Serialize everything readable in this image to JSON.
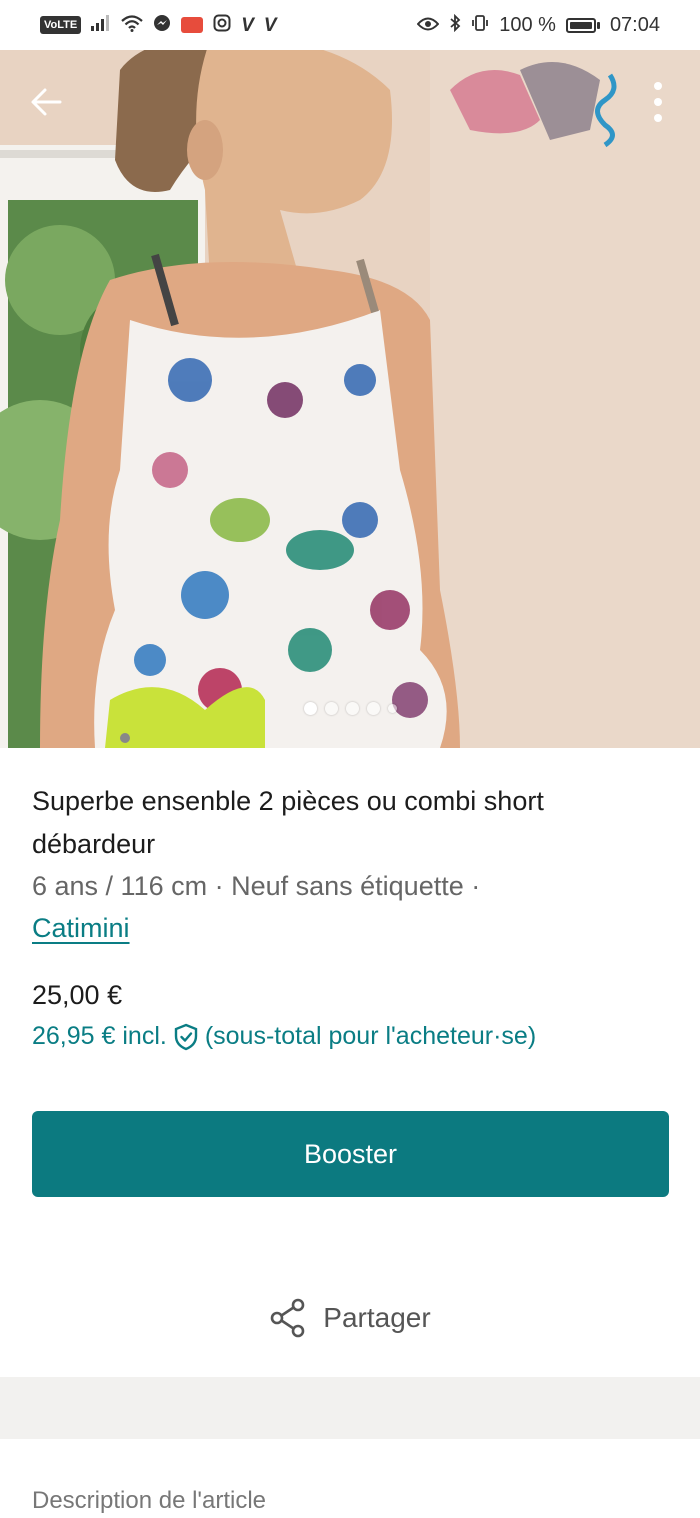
{
  "status_bar": {
    "volte": "VoLTE",
    "letters": [
      "V",
      "V"
    ],
    "battery": "100 %",
    "time": "07:04"
  },
  "gallery": {
    "image_count": 5,
    "active_index": 0
  },
  "item": {
    "title": "Superbe ensenble 2 pièces ou combi short débardeur",
    "meta": "6 ans / 116 cm · Neuf sans étiquette ·",
    "brand": "Catimini",
    "price": "25,00 €",
    "incl_price": "26,95 € incl.",
    "incl_note": "(sous-total pour l'acheteur·se)"
  },
  "actions": {
    "booster_label": "Booster",
    "share_label": "Partager"
  },
  "description": {
    "label": "Description de l'article"
  },
  "colors": {
    "accent": "#0c7a80",
    "link": "#0a7d84"
  }
}
